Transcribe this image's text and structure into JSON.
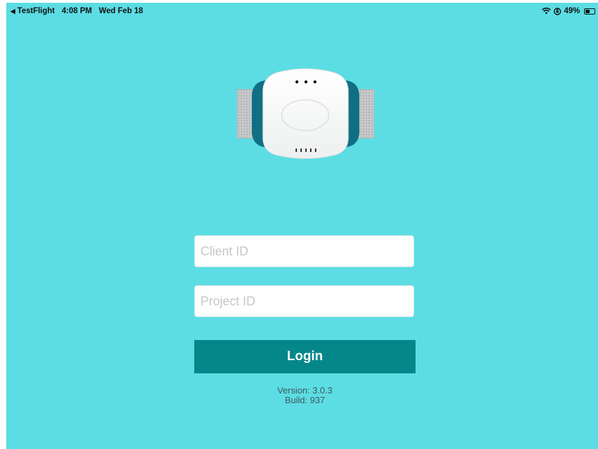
{
  "status_bar": {
    "back_app": "TestFlight",
    "time": "4:08 PM",
    "date": "Wed Feb 18",
    "battery": "49%",
    "wifi_icon": "wifi-icon",
    "orientation_lock_icon": "orientation-lock-icon"
  },
  "login": {
    "client_id_placeholder": "Client ID",
    "project_id_placeholder": "Project ID",
    "login_label": "Login"
  },
  "footer": {
    "version": "Version: 3.0.3",
    "build": "Build: 937"
  },
  "colors": {
    "background": "#5cdde3",
    "button": "#05878a",
    "device_shell": "#0f6f85"
  }
}
